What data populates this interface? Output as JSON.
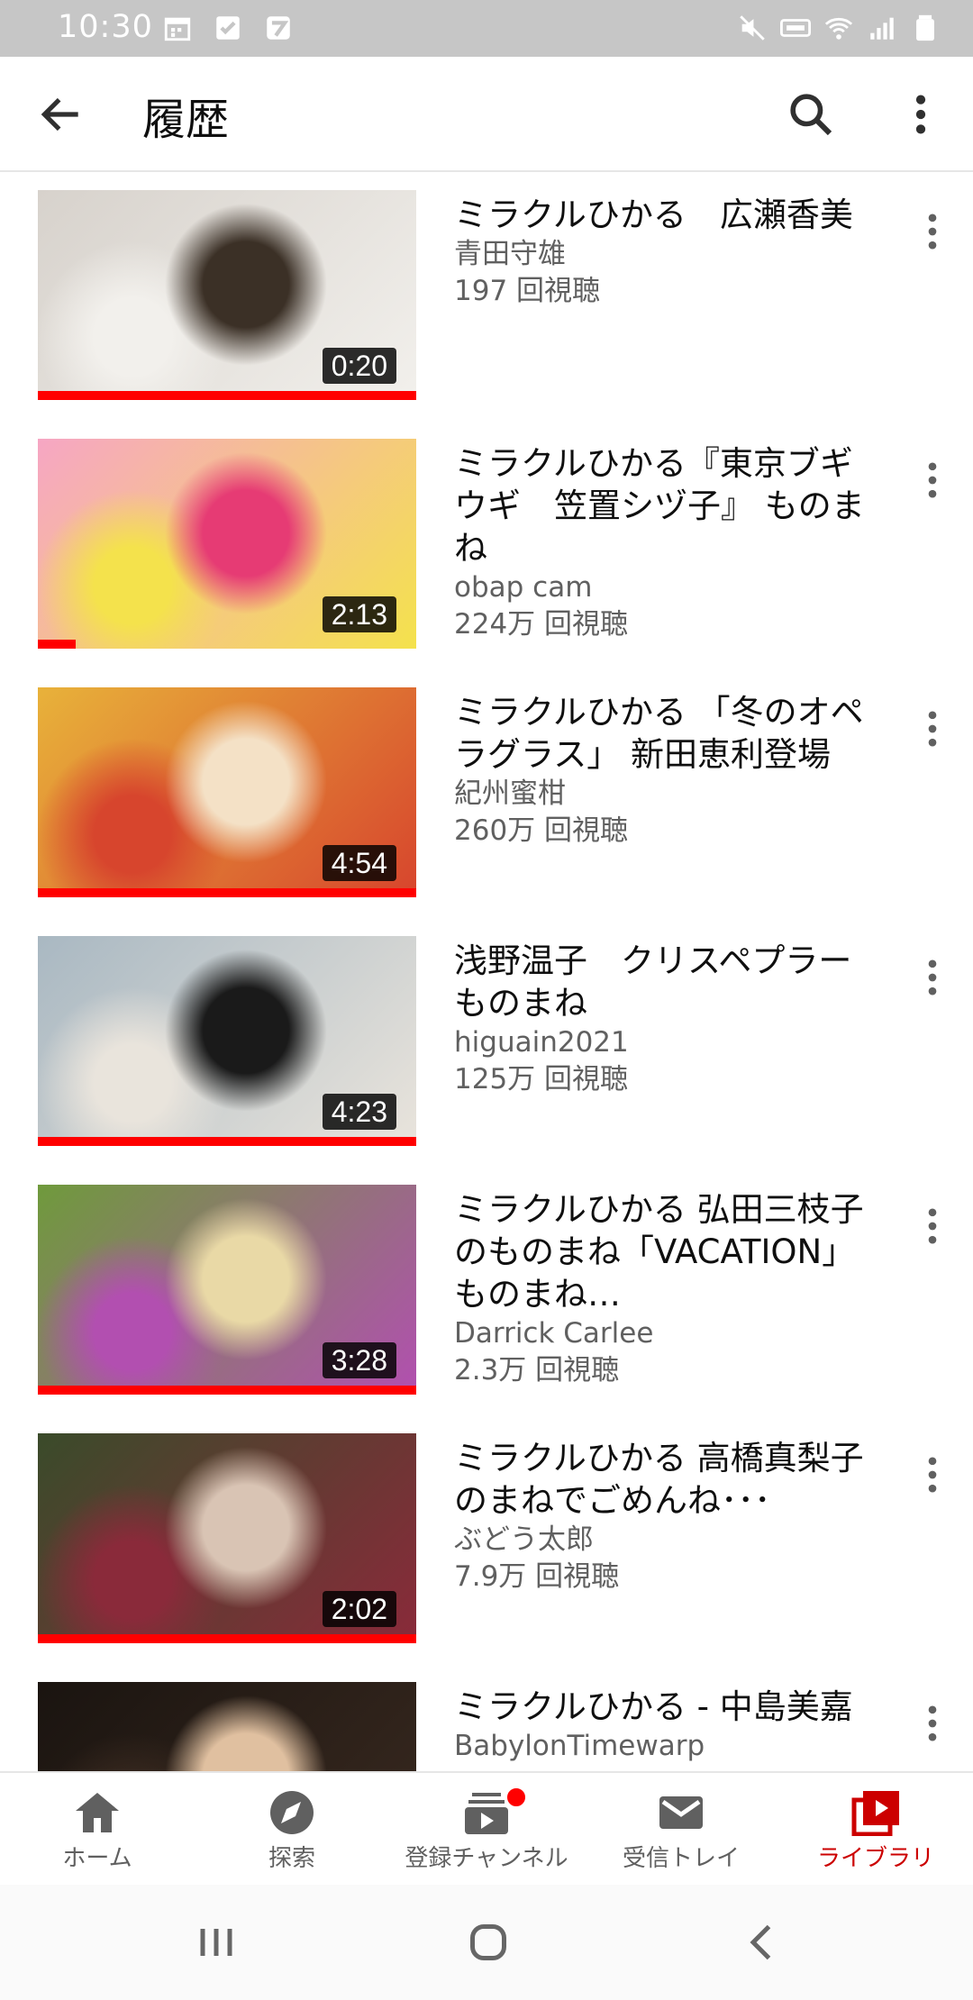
{
  "status_bar": {
    "time": "10:30",
    "left_icons": [
      "calendar-icon",
      "check-icon",
      "app-icon"
    ],
    "right_icons": [
      "mute-icon",
      "volte-icon",
      "wifi-icon",
      "signal-icon",
      "battery-icon"
    ]
  },
  "app_bar": {
    "title": "履歴",
    "back_icon": "arrow-left-icon",
    "search_icon": "search-icon",
    "more_icon": "more-vert-icon"
  },
  "videos": [
    {
      "title": "ミラクルひかる　広瀬香美",
      "channel": "青田守雄",
      "views": "197 回視聴",
      "duration": "0:20",
      "progress": 1.0,
      "thumb_colors": [
        "#d7d2cc",
        "#f2f0ec",
        "#3b3026"
      ]
    },
    {
      "title": "ミラクルひかる『東京ブギウギ　笠置シヅ子』 ものまね",
      "channel": "obap cam",
      "views": "224万 回視聴",
      "duration": "2:13",
      "progress": 0.1,
      "thumb_colors": [
        "#f6a6c4",
        "#f4e24c",
        "#e63b74"
      ]
    },
    {
      "title": "ミラクルひかる 「冬のオペラグラス」 新田恵利登場",
      "channel": "紀州蜜柑",
      "views": "260万 回視聴",
      "duration": "4:54",
      "progress": 1.0,
      "thumb_colors": [
        "#e8b23a",
        "#d7452d",
        "#f4e1c6"
      ]
    },
    {
      "title": "浅野温子　クリスペプラー　ものまね",
      "channel": "higuain2021",
      "views": "125万 回視聴",
      "duration": "4:23",
      "progress": 1.0,
      "thumb_colors": [
        "#a9b8c2",
        "#e9e4dc",
        "#1a1a1a"
      ]
    },
    {
      "title": "ミラクルひかる 弘田三枝子のものまね「VACATION」 ものまね…",
      "channel": "Darrick Carlee",
      "views": "2.3万 回視聴",
      "duration": "3:28",
      "progress": 1.0,
      "thumb_colors": [
        "#6f9a3c",
        "#b24fb0",
        "#e9d9a6"
      ]
    },
    {
      "title": "ミラクルひかる 高橋真梨子のまねでごめんね･･･",
      "channel": "ぶどう太郎",
      "views": "7.9万 回視聴",
      "duration": "2:02",
      "progress": 1.0,
      "thumb_colors": [
        "#3a4b2a",
        "#8a2a3a",
        "#d9c4b4"
      ]
    },
    {
      "title": "ミラクルひかる - 中島美嘉",
      "channel": "BabylonTimewarp",
      "views": "",
      "duration": "",
      "progress": 0,
      "thumb_colors": [
        "#1a1410",
        "#3a2a20",
        "#e0c0a0"
      ]
    }
  ],
  "bottom_nav": [
    {
      "label": "ホーム",
      "icon": "home-icon",
      "active": false
    },
    {
      "label": "探索",
      "icon": "explore-icon",
      "active": false
    },
    {
      "label": "登録チャンネル",
      "icon": "subscriptions-icon",
      "active": false,
      "badge": true
    },
    {
      "label": "受信トレイ",
      "icon": "inbox-icon",
      "active": false
    },
    {
      "label": "ライブラリ",
      "icon": "library-icon",
      "active": true
    }
  ],
  "system_nav": [
    "recents-icon",
    "home-circle-icon",
    "back-chevron-icon"
  ],
  "colors": {
    "accent": "#cc0000",
    "progress": "#ff0000",
    "secondary_text": "#606060"
  }
}
